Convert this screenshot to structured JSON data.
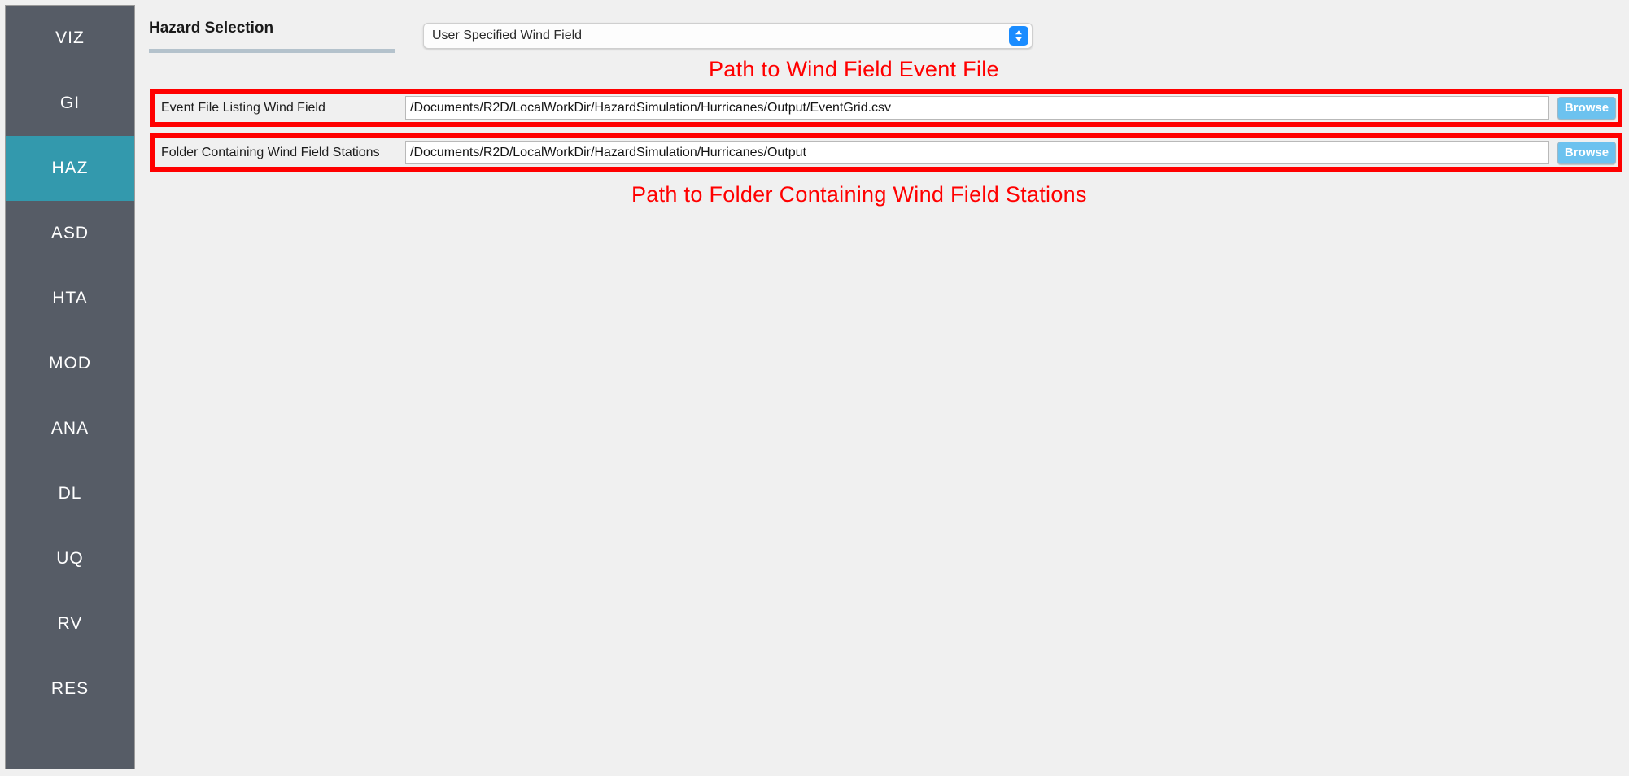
{
  "sidebar": {
    "items": [
      {
        "label": "VIZ",
        "active": false
      },
      {
        "label": "GI",
        "active": false
      },
      {
        "label": "HAZ",
        "active": true
      },
      {
        "label": "ASD",
        "active": false
      },
      {
        "label": "HTA",
        "active": false
      },
      {
        "label": "MOD",
        "active": false
      },
      {
        "label": "ANA",
        "active": false
      },
      {
        "label": "DL",
        "active": false
      },
      {
        "label": "UQ",
        "active": false
      },
      {
        "label": "RV",
        "active": false
      },
      {
        "label": "RES",
        "active": false
      }
    ],
    "active_color": "#3399ad",
    "background_color": "#565c66"
  },
  "hazard": {
    "title": "Hazard Selection",
    "selected_option": "User Specified Wind Field",
    "dropdown_icon": "chevron-up-down-icon",
    "dropdown_accent_color": "#1a8cff"
  },
  "annotations": {
    "color": "#ff0000",
    "top": "Path to Wind Field Event File",
    "bottom": "Path to Folder Containing Wind Field Stations"
  },
  "fields": [
    {
      "label": "Event File Listing Wind Field",
      "value": "/Documents/R2D/LocalWorkDir/HazardSimulation/Hurricanes/Output/EventGrid.csv",
      "placeholder": "",
      "browse_label": "Browse",
      "highlighted": true
    },
    {
      "label": "Folder Containing Wind Field Stations",
      "value": "/Documents/R2D/LocalWorkDir/HazardSimulation/Hurricanes/Output",
      "placeholder": "",
      "browse_label": "Browse",
      "highlighted": true
    }
  ]
}
